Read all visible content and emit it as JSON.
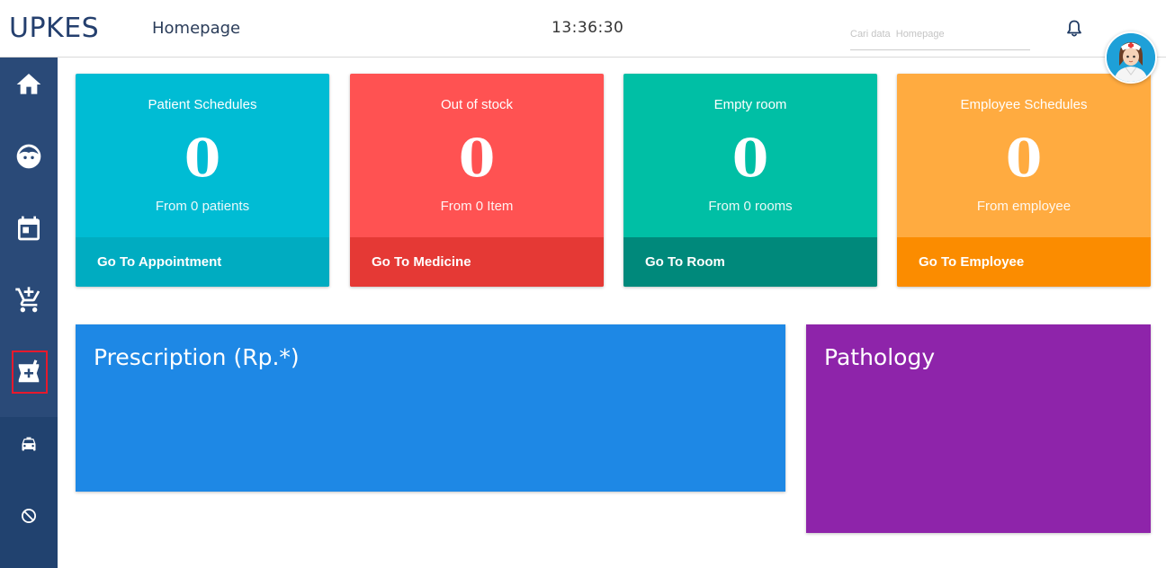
{
  "header": {
    "brand": "UPKES",
    "page_title": "Homepage",
    "clock": "13:36:30",
    "search_placeholder": "Cari data  Homepage",
    "bell_icon": "bell-icon",
    "avatar_icon": "nurse-avatar"
  },
  "sidebar": {
    "items": [
      {
        "icon": "home-icon",
        "selected": false
      },
      {
        "icon": "face-icon",
        "selected": false
      },
      {
        "icon": "calendar-icon",
        "selected": false
      },
      {
        "icon": "add-to-cart-icon",
        "selected": false
      },
      {
        "icon": "medicine-icon",
        "selected": true
      },
      {
        "icon": "car-icon",
        "selected": false
      },
      {
        "icon": "block-icon",
        "selected": false
      }
    ]
  },
  "cards": [
    {
      "title": "Patient Schedules",
      "value": "0",
      "sub": "From 0 patients",
      "link": "Go To Appointment",
      "color": "#00bcd4",
      "foot_color": "#00acc1"
    },
    {
      "title": "Out of stock",
      "value": "0",
      "sub": "From 0 Item",
      "link": "Go To Medicine",
      "color": "#ff5252",
      "foot_color": "#e53935"
    },
    {
      "title": "Empty room",
      "value": "0",
      "sub": "From 0 rooms",
      "link": "Go To Room",
      "color": "#00bfa5",
      "foot_color": "#00897b"
    },
    {
      "title": "Employee Schedules",
      "value": "0",
      "sub": "From employee",
      "link": "Go To Employee",
      "color": "#ffab40",
      "foot_color": "#fb8c00"
    }
  ],
  "panels": {
    "prescription": {
      "title": "Prescription (Rp.*)",
      "color": "#1e88e5"
    },
    "pathology": {
      "title": "Pathology",
      "color": "#8e24aa"
    }
  }
}
